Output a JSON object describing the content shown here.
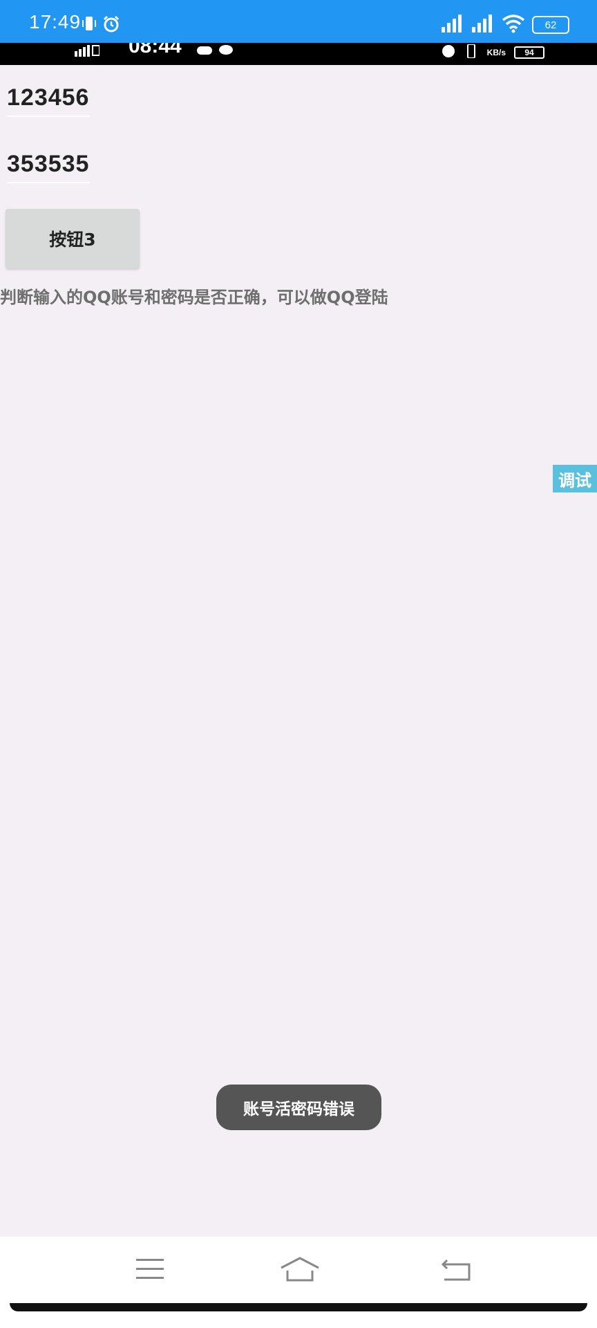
{
  "status_bar": {
    "time": "17:49",
    "battery": "62",
    "color": "#2196f3"
  },
  "inner_status_bar": {
    "time": "08:44",
    "speed_unit": "KB/s",
    "battery": "94"
  },
  "form": {
    "account_value": "123456",
    "password_value": "353535",
    "button_label": "按钮3",
    "description": "判断输入的QQ账号和密码是否正确，可以做QQ登陆"
  },
  "debug_tab": {
    "label": "调试",
    "color": "#5bc0de"
  },
  "toast": {
    "message": "账号活密码错误"
  },
  "navigation": {
    "icons": [
      "menu-icon",
      "home-icon",
      "back-icon"
    ]
  }
}
